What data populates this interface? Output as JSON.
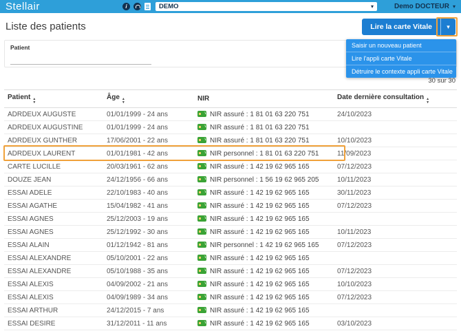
{
  "topbar": {
    "brand": "Stellair",
    "env_value": "DEMO",
    "user_name": "Demo DOCTEUR"
  },
  "page": {
    "title": "Liste des patients",
    "read_vitale_button": "Lire la carte Vitale",
    "dropdown_menu": {
      "items": [
        "Saisir un nouveau patient",
        "Lire l'appli carte Vitale",
        "Détruire le contexte appli carte Vitale"
      ]
    },
    "filter": {
      "label": "Patient",
      "value": ""
    },
    "result_count": "30 sur 30"
  },
  "table": {
    "columns": [
      {
        "label": "Patient",
        "sortable": true
      },
      {
        "label": "Âge",
        "sortable": true
      },
      {
        "label": "NIR",
        "sortable": false
      },
      {
        "label": "Date dernière consultation",
        "sortable": true
      }
    ],
    "rows": [
      {
        "patient": "ADRDEUX AUGUSTE",
        "age": "01/01/1999 - 24 ans",
        "nir": "NIR assuré : 1 81 01 63 220 751",
        "date": "24/10/2023",
        "highlighted": false
      },
      {
        "patient": "ADRDEUX AUGUSTINE",
        "age": "01/01/1999 - 24 ans",
        "nir": "NIR assuré : 1 81 01 63 220 751",
        "date": "",
        "highlighted": false
      },
      {
        "patient": "ADRDEUX GUNTHER",
        "age": "17/06/2001 - 22 ans",
        "nir": "NIR assuré : 1 81 01 63 220 751",
        "date": "10/10/2023",
        "highlighted": false
      },
      {
        "patient": "ADRDEUX LAURENT",
        "age": "01/01/1981 - 42 ans",
        "nir": "NIR personnel : 1 81 01 63 220 751",
        "date": "11/09/2023",
        "highlighted": true
      },
      {
        "patient": "CARTE LUCILLE",
        "age": "20/03/1961 - 62 ans",
        "nir": "NIR assuré : 1 42 19 62 965 165",
        "date": "07/12/2023",
        "highlighted": false
      },
      {
        "patient": "DOUZE JEAN",
        "age": "24/12/1956 - 66 ans",
        "nir": "NIR personnel : 1 56 19 62 965 205",
        "date": "10/11/2023",
        "highlighted": false
      },
      {
        "patient": "ESSAI ADELE",
        "age": "22/10/1983 - 40 ans",
        "nir": "NIR assuré : 1 42 19 62 965 165",
        "date": "30/11/2023",
        "highlighted": false
      },
      {
        "patient": "ESSAI AGATHE",
        "age": "15/04/1982 - 41 ans",
        "nir": "NIR assuré : 1 42 19 62 965 165",
        "date": "07/12/2023",
        "highlighted": false
      },
      {
        "patient": "ESSAI AGNES",
        "age": "25/12/2003 - 19 ans",
        "nir": "NIR assuré : 1 42 19 62 965 165",
        "date": "",
        "highlighted": false
      },
      {
        "patient": "ESSAI AGNES",
        "age": "25/12/1992 - 30 ans",
        "nir": "NIR assuré : 1 42 19 62 965 165",
        "date": "10/11/2023",
        "highlighted": false
      },
      {
        "patient": "ESSAI ALAIN",
        "age": "01/12/1942 - 81 ans",
        "nir": "NIR personnel : 1 42 19 62 965 165",
        "date": "07/12/2023",
        "highlighted": false
      },
      {
        "patient": "ESSAI ALEXANDRE",
        "age": "05/10/2001 - 22 ans",
        "nir": "NIR assuré : 1 42 19 62 965 165",
        "date": "",
        "highlighted": false
      },
      {
        "patient": "ESSAI ALEXANDRE",
        "age": "05/10/1988 - 35 ans",
        "nir": "NIR assuré : 1 42 19 62 965 165",
        "date": "07/12/2023",
        "highlighted": false
      },
      {
        "patient": "ESSAI ALEXIS",
        "age": "04/09/2002 - 21 ans",
        "nir": "NIR assuré : 1 42 19 62 965 165",
        "date": "10/10/2023",
        "highlighted": false
      },
      {
        "patient": "ESSAI ALEXIS",
        "age": "04/09/1989 - 34 ans",
        "nir": "NIR assuré : 1 42 19 62 965 165",
        "date": "07/12/2023",
        "highlighted": false
      },
      {
        "patient": "ESSAI ARTHUR",
        "age": "24/12/2015 - 7 ans",
        "nir": "NIR assuré : 1 42 19 62 965 165",
        "date": "",
        "highlighted": false
      },
      {
        "patient": "ESSAI DESIRE",
        "age": "31/12/2011 - 11 ans",
        "nir": "NIR assuré : 1 42 19 62 965 165",
        "date": "03/10/2023",
        "highlighted": false
      }
    ]
  },
  "colors": {
    "topbar_blue": "#2e9fd9",
    "primary_button_blue": "#1c7ed2",
    "menu_blue": "#2b93ea",
    "annotation_orange": "#f0a13a",
    "vitale_green": "#3aa335",
    "navy_text": "#12324f"
  }
}
